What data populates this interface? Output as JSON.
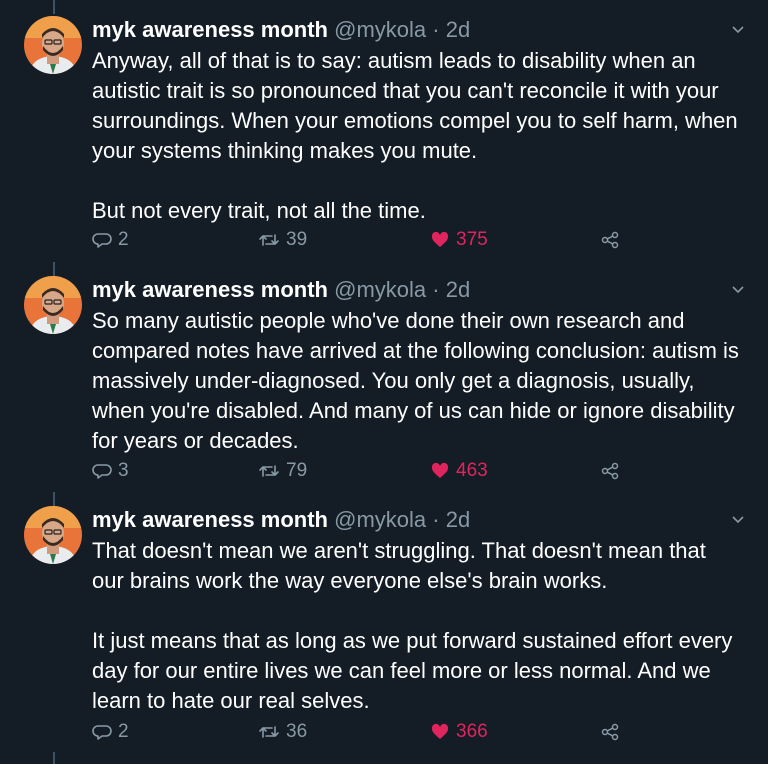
{
  "colors": {
    "background": "#141d26",
    "text": "#ffffff",
    "muted": "#8899a6",
    "like": "#e0245e",
    "thread_line": "#3d5466"
  },
  "tweets": [
    {
      "name": "myk awareness month",
      "handle": "@mykola",
      "dot": "·",
      "time": "2d",
      "paragraphs": [
        "Anyway, all of that is to say: autism leads to disability when an autistic trait is so pronounced that you can't reconcile it with your surroundings. When your emotions compel you to self harm, when your systems thinking makes you mute.",
        "But not every trait, not all the time."
      ],
      "replies": "2",
      "retweets": "39",
      "likes": "375",
      "liked": true,
      "icons": [
        "reply-icon",
        "retweet-icon",
        "heart-icon",
        "share-icon",
        "chevron-down-icon"
      ]
    },
    {
      "name": "myk awareness month",
      "handle": "@mykola",
      "dot": "·",
      "time": "2d",
      "paragraphs": [
        "So many autistic people who've done their own research and compared notes have arrived at the following conclusion: autism is massively under-diagnosed. You only get a diagnosis, usually, when you're disabled. And many of us can hide or ignore disability for years or decades."
      ],
      "replies": "3",
      "retweets": "79",
      "likes": "463",
      "liked": true,
      "icons": [
        "reply-icon",
        "retweet-icon",
        "heart-icon",
        "share-icon",
        "chevron-down-icon"
      ]
    },
    {
      "name": "myk awareness month",
      "handle": "@mykola",
      "dot": "·",
      "time": "2d",
      "paragraphs": [
        "That doesn't mean we aren't struggling. That doesn't mean that our brains work the way everyone else's brain works.",
        "It just means that as long as we put forward sustained effort every day for our entire lives we can feel more or less normal. And we learn to hate our real selves."
      ],
      "replies": "2",
      "retweets": "36",
      "likes": "366",
      "liked": true,
      "icons": [
        "reply-icon",
        "retweet-icon",
        "heart-icon",
        "share-icon",
        "chevron-down-icon"
      ]
    }
  ]
}
